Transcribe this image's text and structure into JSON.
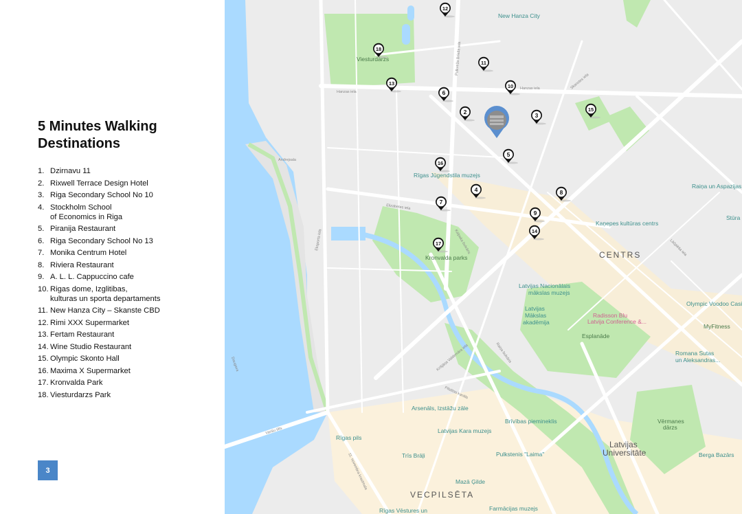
{
  "title": "5 Minutes Walking Destinations",
  "destinations": [
    {
      "num": "1.",
      "text": "Dzirnavu 11"
    },
    {
      "num": "2.",
      "text": "Rixwell Terrace Design Hotel"
    },
    {
      "num": "3.",
      "text": "Riga Secondary School No 10"
    },
    {
      "num": "4.",
      "text": "Stockholm School\nof Economics in Riga"
    },
    {
      "num": "5.",
      "text": "Piranija Restaurant"
    },
    {
      "num": "6.",
      "text": "Riga Secondary School No 13"
    },
    {
      "num": "7.",
      "text": "Monika Centrum Hotel"
    },
    {
      "num": "8.",
      "text": "Riviera Restaurant"
    },
    {
      "num": "9.",
      "text": "A. L. L. Cappuccino cafe"
    },
    {
      "num": "10.",
      "text": "Rigas dome, Izglitibas,\nkulturas un sporta departaments"
    },
    {
      "num": "11.",
      "text": " New Hanza City – Skanste CBD"
    },
    {
      "num": "12.",
      "text": "Rimi XXX Supermarket"
    },
    {
      "num": "13.",
      "text": "Fertam Restaurant"
    },
    {
      "num": "14.",
      "text": "Wine Studio Restaurant"
    },
    {
      "num": "15.",
      "text": "Olympic Skonto Hall"
    },
    {
      "num": "16.",
      "text": "Maxima X Supermarket"
    },
    {
      "num": "17.",
      "text": "Kronvalda Park"
    },
    {
      "num": "18.",
      "text": "Viesturdarzs Park"
    }
  ],
  "page_number": "3",
  "map": {
    "markers": [
      "2",
      "3",
      "4",
      "5",
      "6",
      "7",
      "8",
      "9",
      "10",
      "11",
      "12",
      "13",
      "14",
      "15",
      "16",
      "17",
      "18"
    ],
    "places": {
      "new_hanza": "New Hanza City",
      "viesturdarzs": "Viesturdārzs",
      "jugendstila": "Rīgas Jūgendstila muzejs",
      "kanepes": "Kaņepes kultūras centrs",
      "centrs": "CENTRS",
      "kronvalda": "Kronvalda parks",
      "nac_muzejs_1": "Latvijas Nacionālais",
      "nac_muzejs_2": "mākslas muzejs",
      "akademija_1": "Latvijas",
      "akademija_2": "Mākslas",
      "akademija_3": "akadēmija",
      "radisson_1": "Radisson Blu",
      "radisson_2": "Latvija Conference &...",
      "esplanade": "Esplanāde",
      "voodoo": "Olympic Voodoo Casino",
      "myfitness": "MyFitness",
      "romana_1": "Romana Sutas",
      "romana_2": "un Aleksandras...",
      "raina": "Raiņa un Aspazijas m",
      "stura": "Stūra N",
      "arsenals": "Arsenāls, Izstāžu zāle",
      "kara_muzejs": "Latvijas Kara muzejs",
      "brivibas": "Brīvības piemineklis",
      "rigas_pils": "Rīgas pils",
      "tris_brali": "Trīs Brāļi",
      "laima": "Pulkstenis \"Laima\"",
      "maza_gilde": "Mazā Ģilde",
      "vecpilseta": "VECPILSĒTA",
      "vestures": "Rīgas Vēstures un",
      "farmacijas": "Farmācijas muzejs",
      "vermanes_1": "Vērmanes",
      "vermanes_2": "dārzs",
      "universitate_1": "Latvijas",
      "universitate_2": "Universitāte",
      "berga": "Berga Bazārs",
      "andrejsala": "Andrejsala",
      "daugava": "Daugava",
      "hanzas": "Hanzas iela",
      "skanstes": "Skanstes iela",
      "pulkveza": "Pulkveža Brieža iela",
      "elizabetes": "Elizabetes iela",
      "kalpaka": "Kalpaka bulvāris",
      "eksporta": "Eksporta iela",
      "krisjana": "Krišjāņa Valdemāra iela",
      "raina_bulv": "Raiņa bulvāris",
      "lacplesa": "Lāčplēša iela",
      "krastmala": "11. novembra krastmala",
      "kanals": "Pilsētas kanāls",
      "vansu": "Vanšu tilts"
    }
  },
  "colors": {
    "water": "#aadaff",
    "park": "#c0e8b0",
    "road": "#ffffff",
    "land": "#ececec",
    "oldtown": "#fbf1dc",
    "page_badge": "#4a86c8",
    "marker": "#111111",
    "photo_pin": "#5b8fcf"
  }
}
